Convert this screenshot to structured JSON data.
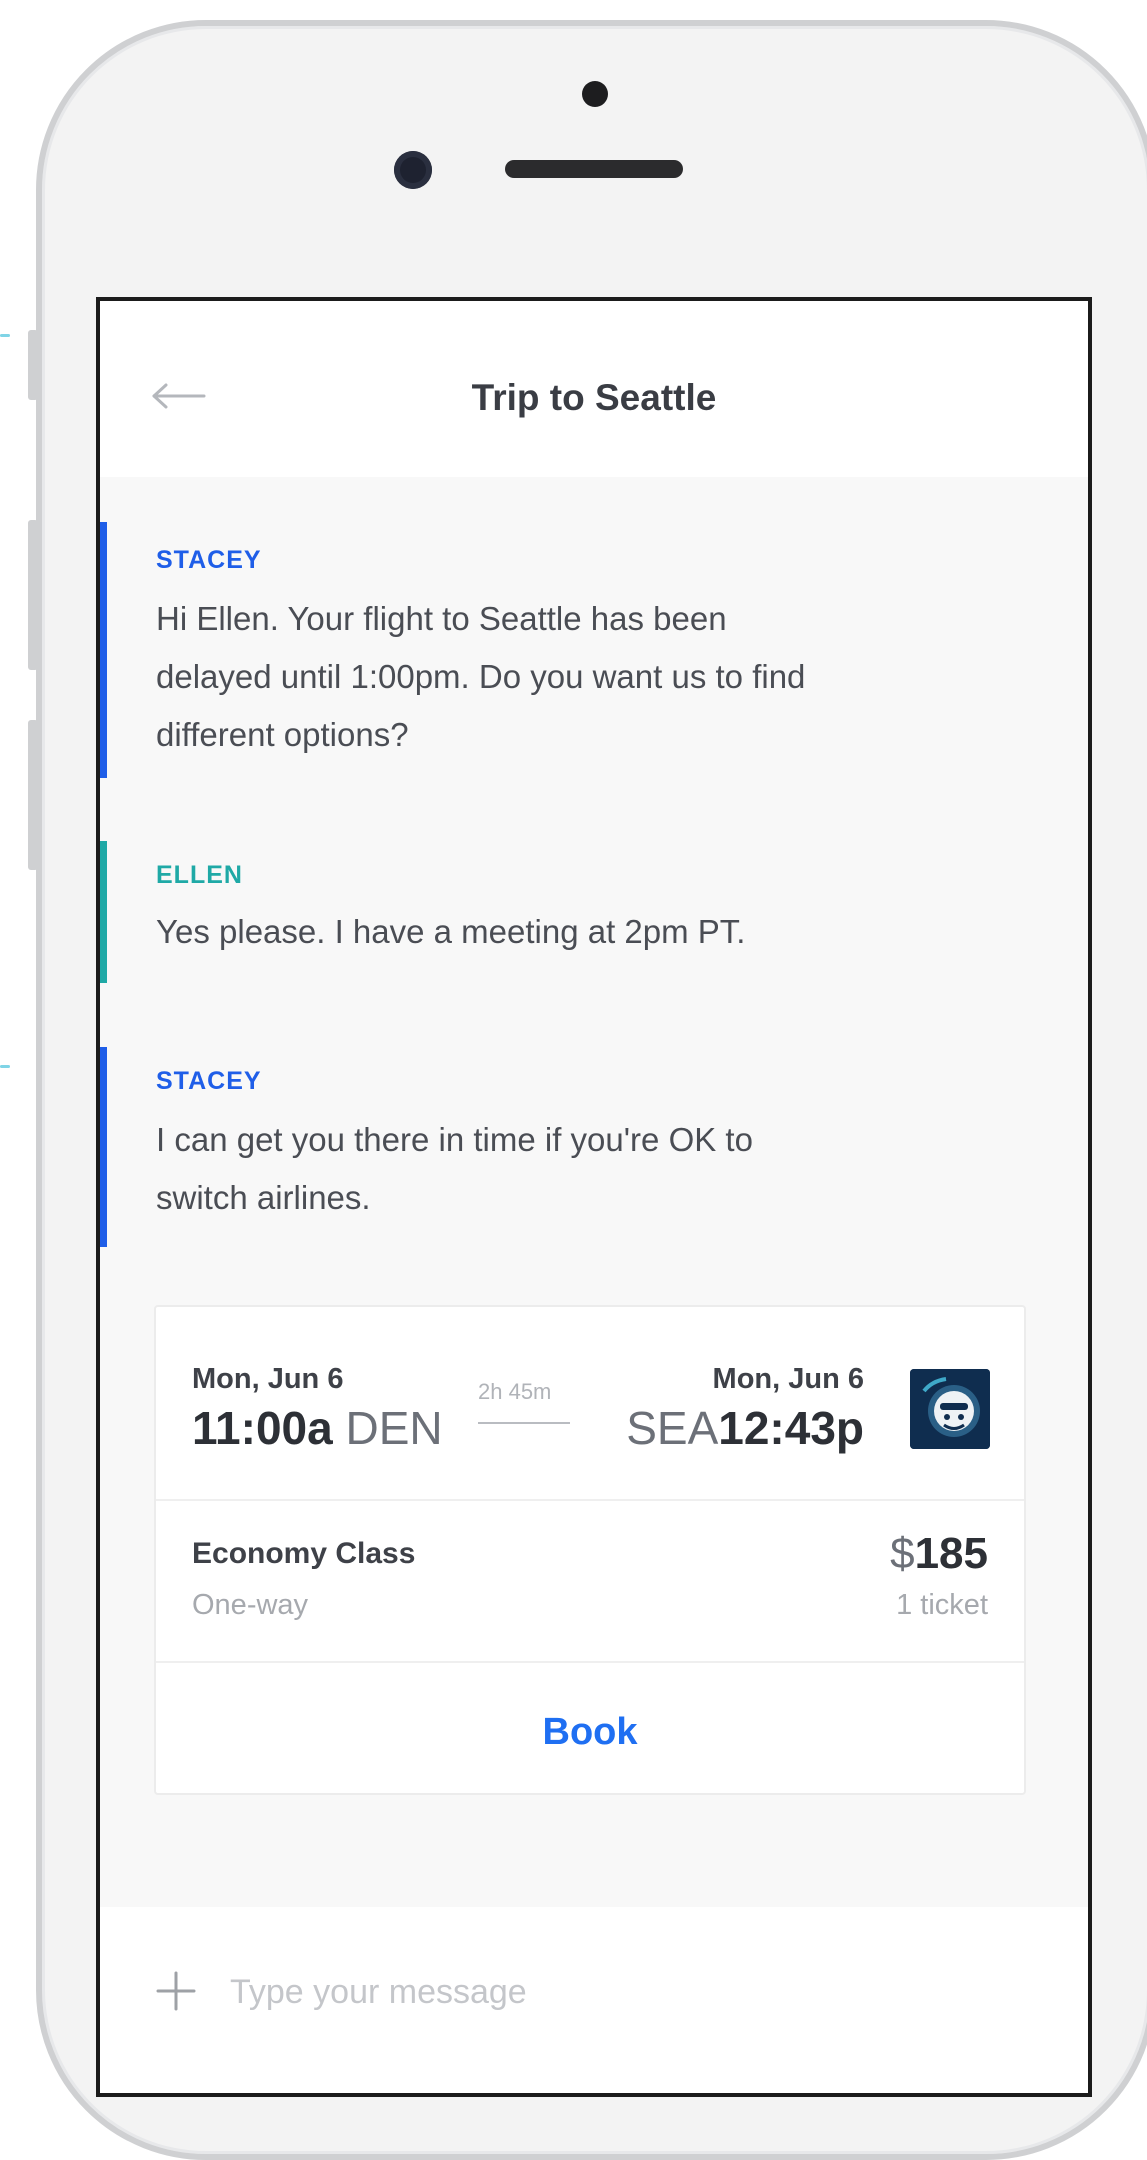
{
  "header": {
    "title": "Trip to Seattle",
    "back_icon": "arrow-left-icon"
  },
  "colors": {
    "agent_accent": "#1f5ee8",
    "user_accent": "#1fa9a6",
    "link_blue": "#1f6ff2"
  },
  "messages": [
    {
      "sender": "STACEY",
      "role": "agent",
      "lines": [
        "Hi Ellen. Your flight to Seattle has been",
        "delayed until 1:00pm. Do you want us to find",
        "different options?"
      ]
    },
    {
      "sender": "ELLEN",
      "role": "user",
      "lines": [
        "Yes please. I have a meeting at 2pm PT."
      ]
    },
    {
      "sender": "STACEY",
      "role": "agent",
      "lines": [
        "I can get you there in time if you're OK to",
        "switch airlines."
      ]
    }
  ],
  "flight_card": {
    "departure": {
      "date": "Mon, Jun 6",
      "time": "11:00a",
      "airport": "DEN"
    },
    "arrival": {
      "date": "Mon, Jun 6",
      "time": "12:43p",
      "airport": "SEA"
    },
    "duration": "2h 45m",
    "airline_icon": "airline-logo-icon",
    "fare_class": "Economy Class",
    "trip_type": "One-way",
    "price_currency": "$",
    "price_amount": "185",
    "ticket_count": "1 ticket",
    "book_label": "Book"
  },
  "composer": {
    "placeholder": "Type your message",
    "add_icon": "plus-icon"
  }
}
